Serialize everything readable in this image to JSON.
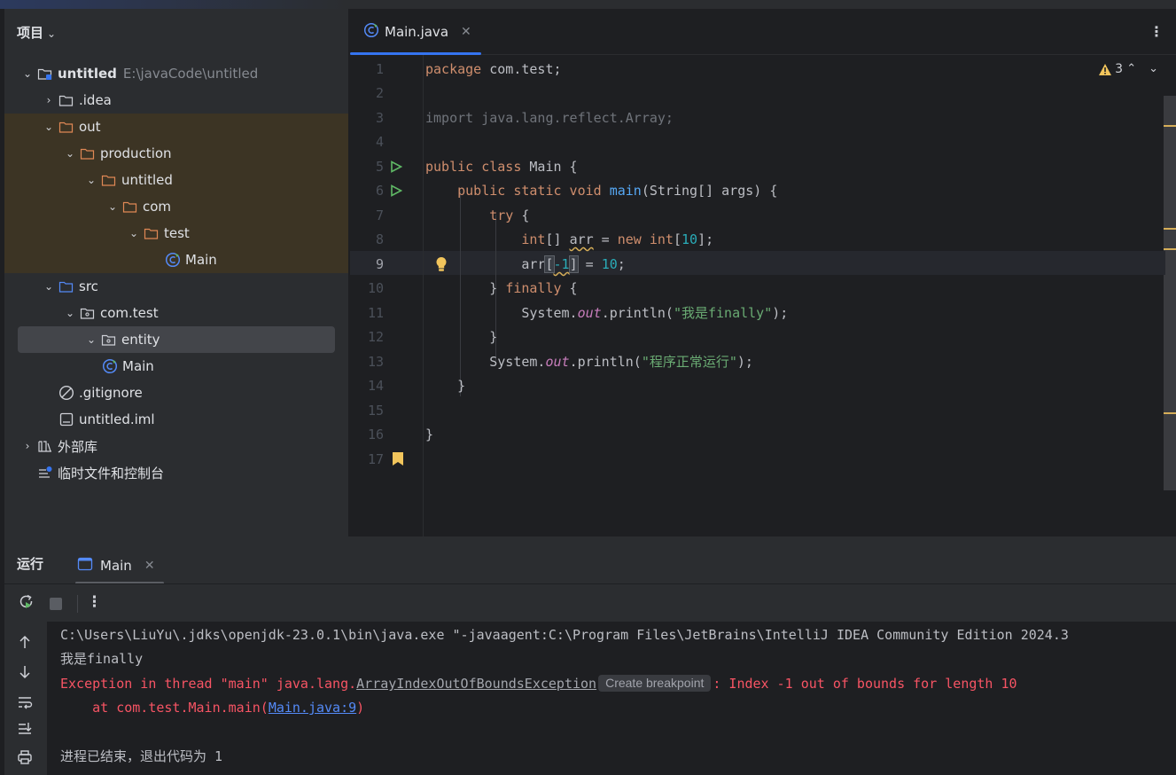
{
  "project_panel": {
    "title": "项目",
    "tree": [
      {
        "label": "untitled",
        "path": "E:\\javaCode\\untitled"
      },
      {
        "label": ".idea"
      },
      {
        "label": "out"
      },
      {
        "label": "production"
      },
      {
        "label": "untitled"
      },
      {
        "label": "com"
      },
      {
        "label": "test"
      },
      {
        "label": "Main"
      },
      {
        "label": "src"
      },
      {
        "label": "com.test"
      },
      {
        "label": "entity"
      },
      {
        "label": "Main"
      },
      {
        "label": ".gitignore"
      },
      {
        "label": "untitled.iml"
      },
      {
        "label": "外部库"
      },
      {
        "label": "临时文件和控制台"
      }
    ]
  },
  "editor": {
    "tab_label": "Main.java",
    "warnings_count": "3",
    "line_numbers": [
      "1",
      "2",
      "3",
      "4",
      "5",
      "6",
      "7",
      "8",
      "9",
      "10",
      "11",
      "12",
      "13",
      "14",
      "15",
      "16",
      "17"
    ],
    "current_line": "9"
  },
  "run_panel": {
    "title": "运行",
    "tab_label": "Main",
    "console": {
      "command": "C:\\Users\\LiuYu\\.jdks\\openjdk-23.0.1\\bin\\java.exe \"-javaagent:C:\\Program Files\\JetBrains\\IntelliJ IDEA Community Edition 2024.3",
      "stdout_1": "我是finally",
      "exc_prefix": "Exception in thread \"main\" java.lang.",
      "exc_class": "ArrayIndexOutOfBoundsException",
      "breakpoint_chip": "Create breakpoint",
      "exc_suffix": ": Index -1 out of bounds for length 10",
      "at_prefix": "    at com.test.Main.main(",
      "at_link": "Main.java:9",
      "at_suffix": ")",
      "exit_msg": "进程已结束，退出代码为 1"
    }
  },
  "colors": {
    "accent": "#3574f0",
    "error": "#f75464",
    "warning": "#d6ae58",
    "run_green": "#5fb865"
  }
}
